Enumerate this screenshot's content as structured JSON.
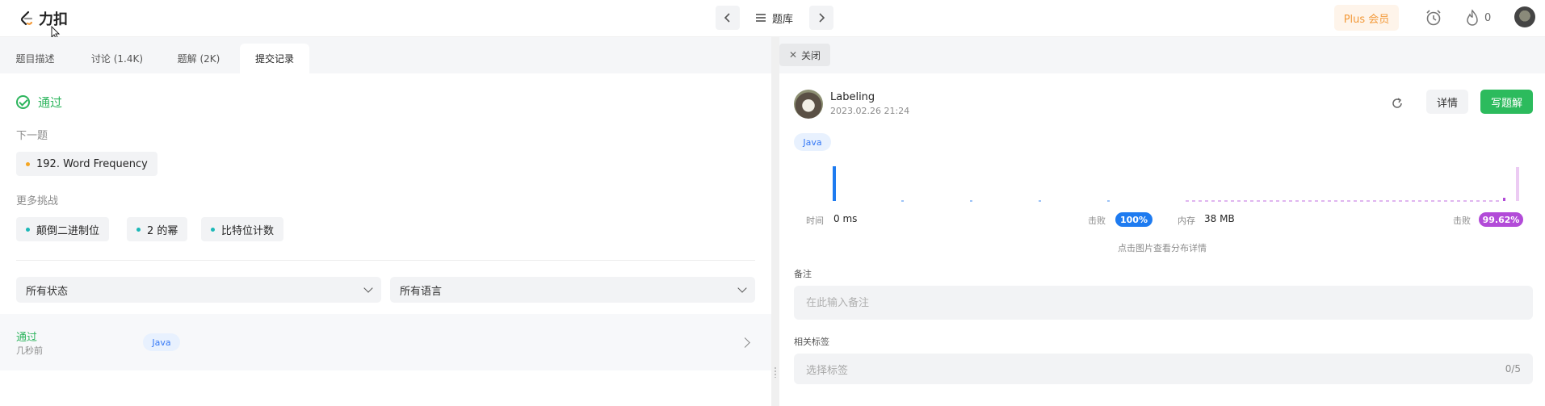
{
  "topbar": {
    "logo_text": "力扣",
    "problemset_label": "题库",
    "plus_label": "Plus 会员",
    "streak_count": "0"
  },
  "tabs": [
    {
      "label": "题目描述"
    },
    {
      "label": "讨论 (1.4K)"
    },
    {
      "label": "题解 (2K)"
    },
    {
      "label": "提交记录"
    }
  ],
  "result": {
    "status": "通过",
    "next_label": "下一题",
    "next_problem": "192. Word Frequency",
    "more_label": "更多挑战",
    "challenges": [
      "颠倒二进制位",
      "2 的幂",
      "比特位计数"
    ]
  },
  "filters": {
    "status_select": "所有状态",
    "language_select": "所有语言"
  },
  "submission_row": {
    "status": "通过",
    "time": "几秒前",
    "language": "Java"
  },
  "detail": {
    "close_label": "关闭",
    "username": "Labeling",
    "date": "2023.02.26 21:24",
    "language": "Java",
    "detail_label": "详情",
    "write_label": "写题解",
    "runtime_label": "时间",
    "runtime_value": "0 ms",
    "runtime_beat_label": "击败",
    "runtime_beat": "100%",
    "memory_label": "内存",
    "memory_value": "38 MB",
    "memory_beat_label": "击败",
    "memory_beat": "99.62%",
    "chart_hint": "点击图片查看分布详情",
    "note_label": "备注",
    "note_placeholder": "在此输入备注",
    "tags_label": "相关标签",
    "tags_placeholder": "选择标签",
    "tags_count": "0/5"
  },
  "colors": {
    "accept_green": "#2db55d",
    "runtime_blue": "#1e7bf0",
    "memory_purple": "#b24bd8",
    "plus_orange": "#f39a3a"
  }
}
